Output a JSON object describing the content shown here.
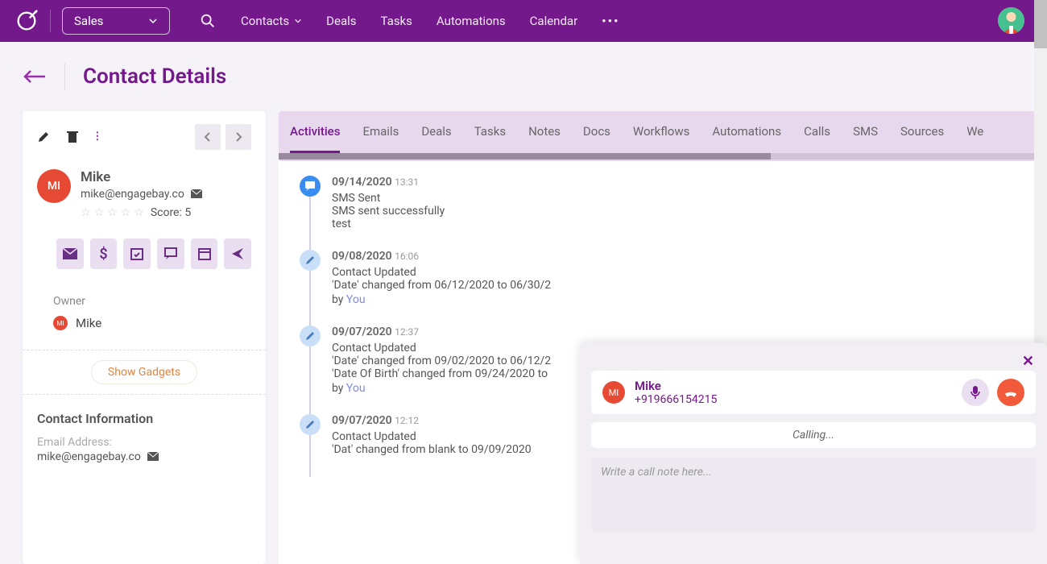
{
  "header": {
    "module": "Sales",
    "nav": [
      "Contacts",
      "Deals",
      "Tasks",
      "Automations",
      "Calendar"
    ]
  },
  "page": {
    "title": "Contact Details"
  },
  "contact": {
    "initials": "MI",
    "name": "Mike",
    "email": "mike@engagebay.co",
    "score_label": "Score: 5",
    "owner_label": "Owner",
    "owner_name": "Mike",
    "owner_initials": "MI",
    "show_gadgets": "Show Gadgets",
    "ci_title": "Contact Information",
    "email_label": "Email Address:",
    "email_value": "mike@engagebay.co"
  },
  "tabs": [
    "Activities",
    "Emails",
    "Deals",
    "Tasks",
    "Notes",
    "Docs",
    "Workflows",
    "Automations",
    "Calls",
    "SMS",
    "Sources",
    "We"
  ],
  "activities": [
    {
      "date": "09/14/2020",
      "time": "13:31",
      "title": "SMS Sent",
      "line1": "SMS sent successfully",
      "line2": "test",
      "by": "",
      "icon": "sms"
    },
    {
      "date": "09/08/2020",
      "time": "16:06",
      "title": "Contact Updated",
      "line1": "'Date' changed from 06/12/2020 to 06/30/2",
      "line2": "",
      "by": "You",
      "icon": "edit"
    },
    {
      "date": "09/07/2020",
      "time": "12:37",
      "title": "Contact Updated",
      "line1": "'Date' changed from 09/02/2020 to 06/12/2",
      "line2": "'Date Of Birth' changed from 09/24/2020 to",
      "by": "You",
      "icon": "edit"
    },
    {
      "date": "09/07/2020",
      "time": "12:12",
      "title": "Contact Updated",
      "line1": "'Dat' changed from blank to 09/09/2020",
      "line2": "",
      "by": "",
      "icon": "edit"
    }
  ],
  "by_label": "by ",
  "call": {
    "initials": "MI",
    "name": "Mike",
    "phone": "+919666154215",
    "status": "Calling...",
    "note_placeholder": "Write a call note here..."
  }
}
